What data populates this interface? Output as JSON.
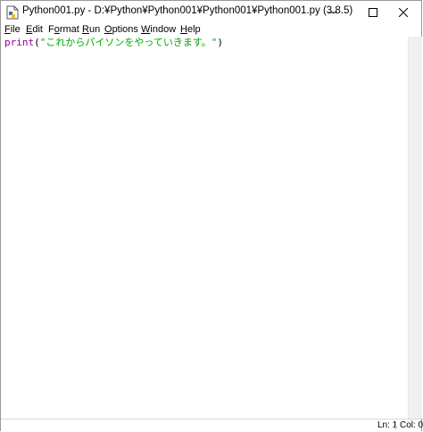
{
  "window": {
    "title": "Python001.py - D:¥Python¥Python001¥Python001¥Python001.py (3.8.5)",
    "controls": {
      "minimize": "—",
      "maximize": "☐",
      "close": "✕"
    }
  },
  "menu": {
    "items": [
      {
        "label": "File",
        "accel": "F",
        "rest": "ile"
      },
      {
        "label": "Edit",
        "accel": "E",
        "rest": "dit"
      },
      {
        "label": "Format",
        "accel": "o",
        "pre": "F",
        "rest": "rmat"
      },
      {
        "label": "Run",
        "accel": "R",
        "rest": "un"
      },
      {
        "label": "Options",
        "accel": "O",
        "rest": "ptions"
      },
      {
        "label": "Window",
        "accel": "W",
        "rest": "indow"
      },
      {
        "label": "Help",
        "accel": "H",
        "rest": "elp"
      }
    ]
  },
  "editor": {
    "line1": {
      "builtin": "print",
      "open": "(",
      "string": "\"これからパイソンをやっていきます。\"",
      "close": ")"
    }
  },
  "status": {
    "ln": "Ln: 1",
    "col": "Col: 0"
  }
}
